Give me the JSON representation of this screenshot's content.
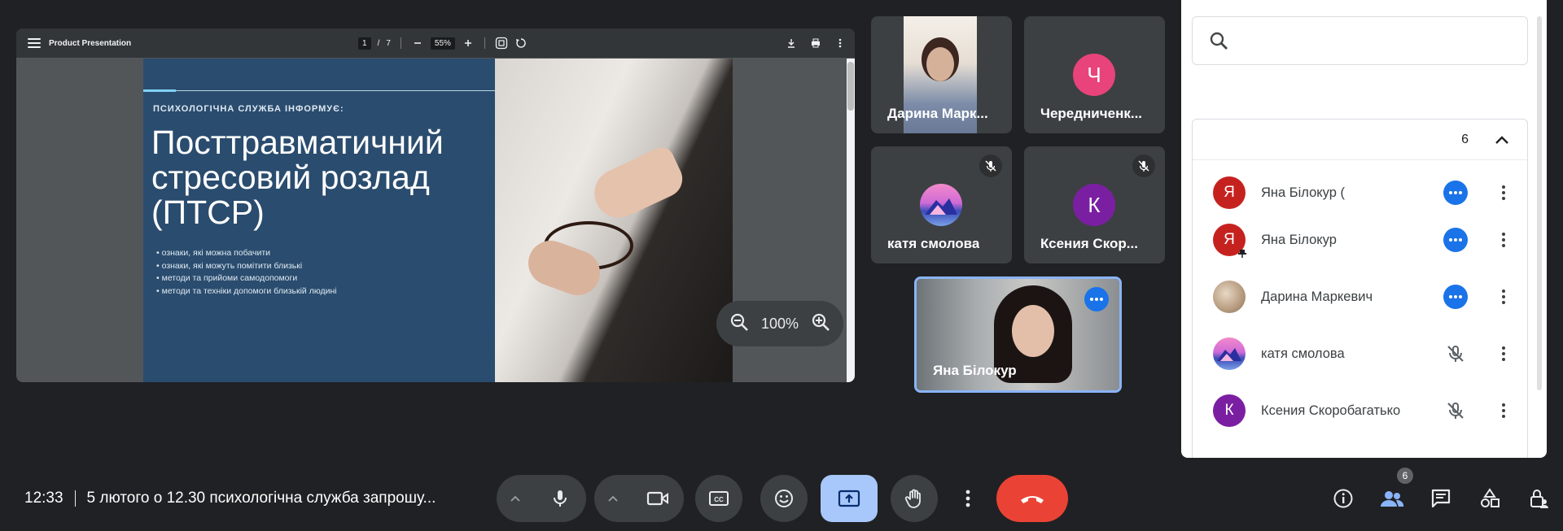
{
  "presentation": {
    "doc_title": "Product Presentation",
    "page_current": "1",
    "page_sep": "/",
    "page_total": "7",
    "zoom": "55%",
    "slide": {
      "kicker": "ПСИХОЛОГІЧНА СЛУЖБА ІНФОРМУЄ:",
      "title": "Посттравматичний стресовий розлад (ПТСР)",
      "bullets": [
        "ознаки, які можна побачити",
        "ознаки, які можуть помітити близькі",
        "методи та прийоми самодопомоги",
        "методи та техніки допомоги близькій людині"
      ]
    },
    "zoom_pill_value": "100%"
  },
  "tiles": [
    {
      "name": "Дарина Марк..."
    },
    {
      "name": "Чередниченк...",
      "initial": "Ч",
      "color": "#e8437a"
    },
    {
      "name": "катя смолова"
    },
    {
      "name": "Ксения Скор...",
      "initial": "К",
      "color": "#7b1fa2"
    },
    {
      "name": "Яна Білокур"
    }
  ],
  "people_panel": {
    "search_placeholder": "",
    "group_count": "6",
    "people": [
      {
        "name": "Яна Білокур (",
        "initial": "Я",
        "color": "#c5221f",
        "state": "more"
      },
      {
        "name": "Яна Білокур",
        "initial": "Я",
        "color": "#c5221f",
        "state": "more"
      },
      {
        "name": "Дарина Маркевич",
        "initial": "",
        "color": "#b59a7e",
        "state": "more"
      },
      {
        "name": "катя смолова",
        "initial": "",
        "color": "#d0649c",
        "state": "muted"
      },
      {
        "name": "Ксения Скоробагатько",
        "initial": "К",
        "color": "#7b1fa2",
        "state": "muted"
      }
    ]
  },
  "bottom_bar": {
    "time": "12:33",
    "meeting_title": "5 лютого о 12.30 психологічна служба запрошу...",
    "people_badge": "6"
  },
  "colors": {
    "accent_blue": "#1a73e8",
    "end_call_red": "#ea4335",
    "active_present": "#a8c7fa"
  }
}
